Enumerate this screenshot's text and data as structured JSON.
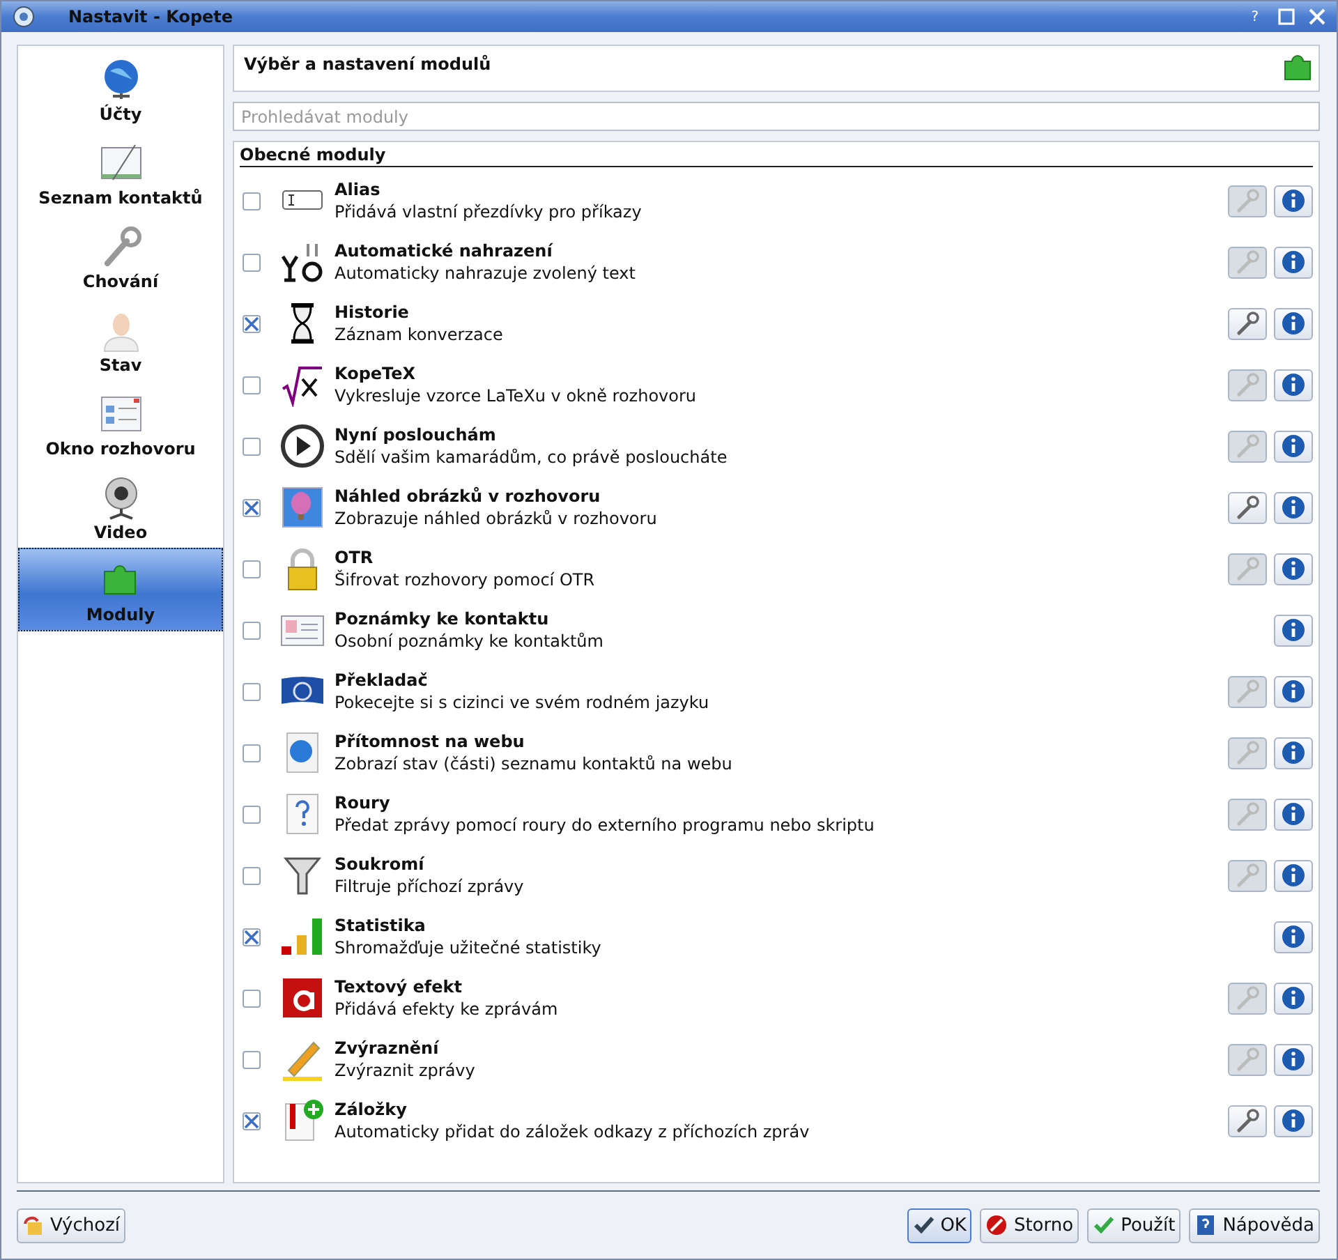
{
  "window": {
    "title": "Nastavit - Kopete",
    "buttons": [
      "?"
    ]
  },
  "sidebar": {
    "items": [
      {
        "label": "Účty",
        "selected": false
      },
      {
        "label": "Seznam kontaktů",
        "selected": false
      },
      {
        "label": "Chování",
        "selected": false
      },
      {
        "label": "Stav",
        "selected": false
      },
      {
        "label": "Okno rozhovoru",
        "selected": false
      },
      {
        "label": "Video",
        "selected": false
      },
      {
        "label": "Moduly",
        "selected": true
      }
    ]
  },
  "header": {
    "title": "Výběr a nastavení modulů"
  },
  "search": {
    "placeholder": "Prohledávat moduly"
  },
  "modules": {
    "group": "Obecné moduly",
    "items": [
      {
        "name": "Alias",
        "description": "Přidává vlastní přezdívky pro příkazy",
        "checked": false,
        "settings": true
      },
      {
        "name": "Automatické nahrazení",
        "description": "Automaticky nahrazuje zvolený text",
        "checked": false,
        "settings": true
      },
      {
        "name": "Historie",
        "description": "Záznam konverzace",
        "checked": true,
        "settings": true
      },
      {
        "name": "KopeTeX",
        "description": "Vykresluje vzorce LaTeXu v okně rozhovoru",
        "checked": false,
        "settings": true
      },
      {
        "name": "Nyní poslouchám",
        "description": "Sdělí vašim kamarádům, co právě posloucháte",
        "checked": false,
        "settings": true
      },
      {
        "name": "Náhled obrázků v rozhovoru",
        "description": "Zobrazuje náhled obrázků v rozhovoru",
        "checked": true,
        "settings": true
      },
      {
        "name": "OTR",
        "description": "Šifrovat rozhovory pomocí OTR",
        "checked": false,
        "settings": true
      },
      {
        "name": "Poznámky ke kontaktu",
        "description": "Osobní poznámky ke kontaktům",
        "checked": false,
        "settings": false
      },
      {
        "name": "Překladač",
        "description": "Pokecejte si s cizinci ve svém rodném jazyku",
        "checked": false,
        "settings": true
      },
      {
        "name": "Přítomnost na webu",
        "description": "Zobrazí stav (části) seznamu kontaktů na webu",
        "checked": false,
        "settings": true
      },
      {
        "name": "Roury",
        "description": "Předat zprávy pomocí roury do externího programu nebo skriptu",
        "checked": false,
        "settings": true
      },
      {
        "name": "Soukromí",
        "description": "Filtruje příchozí zprávy",
        "checked": false,
        "settings": true
      },
      {
        "name": "Statistika",
        "description": "Shromažďuje užitečné statistiky",
        "checked": true,
        "settings": false
      },
      {
        "name": "Textový efekt",
        "description": "Přidává efekty ke zprávám",
        "checked": false,
        "settings": true
      },
      {
        "name": "Zvýraznění",
        "description": "Zvýraznit zprávy",
        "checked": false,
        "settings": true
      },
      {
        "name": "Záložky",
        "description": "Automaticky přidat do záložek odkazy z příchozích zpráv",
        "checked": true,
        "settings": true
      }
    ]
  },
  "footer": {
    "buttons": [
      {
        "label": "Výchozí",
        "focused": false
      },
      {
        "label": "OK",
        "focused": true
      },
      {
        "label": "Storno",
        "focused": false
      },
      {
        "label": "Použít",
        "focused": false
      },
      {
        "label": "Nápověda",
        "focused": false
      }
    ]
  }
}
